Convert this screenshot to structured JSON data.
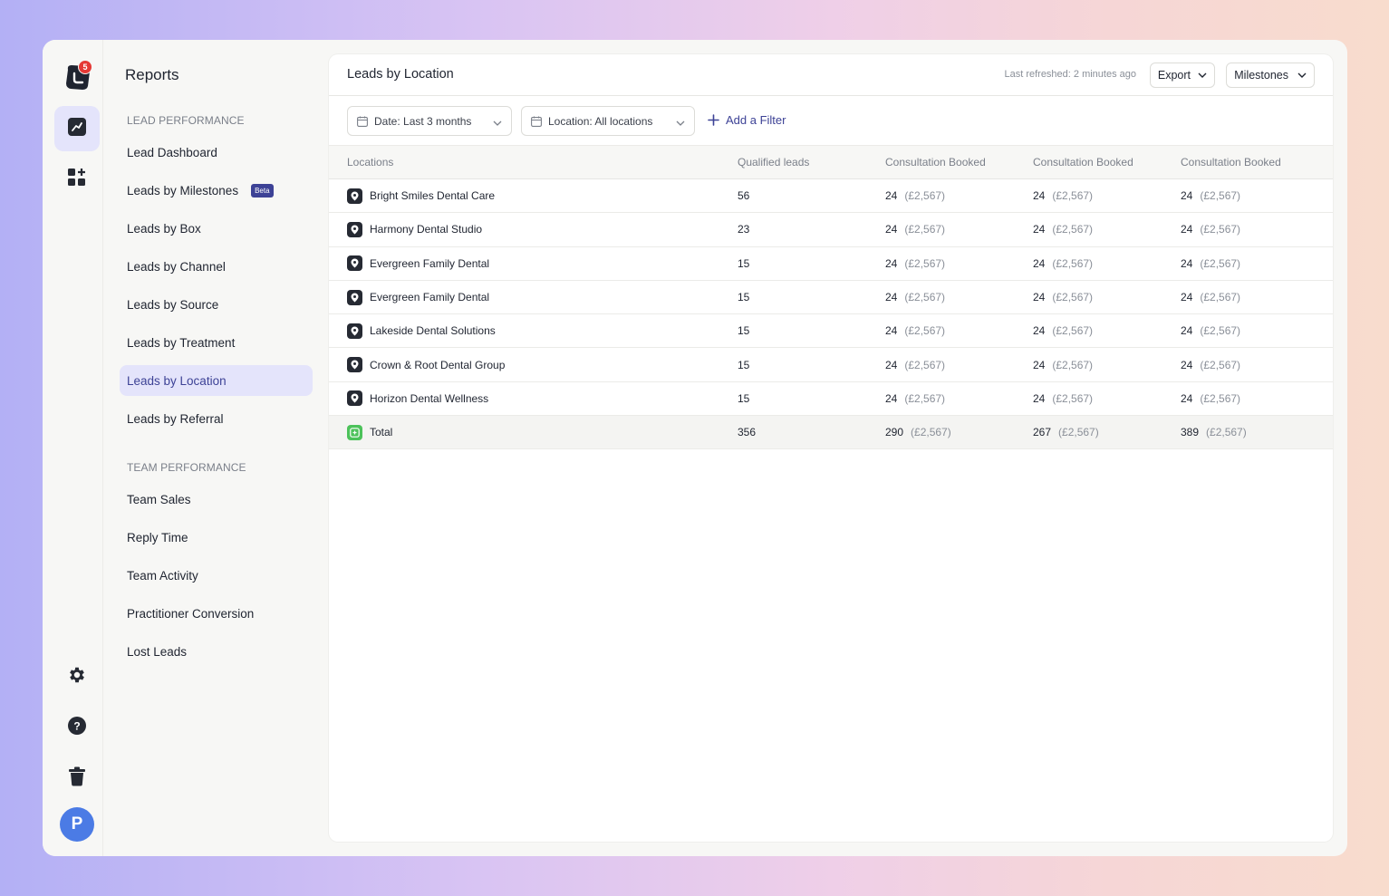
{
  "app": {
    "notification_count": "5",
    "user_initial": "P"
  },
  "nav": {
    "title": "Reports",
    "sections": [
      {
        "heading": "LEAD PERFORMANCE"
      },
      {
        "heading": "TEAM PERFORMANCE"
      }
    ],
    "items": [
      {
        "label": "Lead Dashboard"
      },
      {
        "label": "Leads by Milestones",
        "badge": "Beta"
      },
      {
        "label": "Leads by Box"
      },
      {
        "label": "Leads by Channel"
      },
      {
        "label": "Leads by Source"
      },
      {
        "label": "Leads by Treatment"
      },
      {
        "label": "Leads by Location",
        "active": true
      },
      {
        "label": "Leads by Referral"
      },
      {
        "label": "Team Sales"
      },
      {
        "label": "Reply Time"
      },
      {
        "label": "Team Activity"
      },
      {
        "label": "Practitioner Conversion"
      },
      {
        "label": "Lost Leads"
      }
    ]
  },
  "header": {
    "title": "Leads by Location",
    "last_refreshed": "Last refreshed: 2 minutes ago",
    "export_label": "Export",
    "milestones_label": "Milestones"
  },
  "filters": {
    "date": "Date: Last 3 months",
    "location": "Location: All locations",
    "add_filter": "Add a Filter"
  },
  "table": {
    "columns": [
      "Locations",
      "Qualified leads",
      "Consultation Booked",
      "Consultation Booked",
      "Consultation Booked"
    ],
    "rows": [
      {
        "name": "Bright Smiles Dental Care",
        "qualified": "56",
        "c1": "24",
        "a1": "(£2,567)",
        "c2": "24",
        "a2": "(£2,567)",
        "c3": "24",
        "a3": "(£2,567)"
      },
      {
        "name": "Harmony Dental Studio",
        "qualified": "23",
        "c1": "24",
        "a1": "(£2,567)",
        "c2": "24",
        "a2": "(£2,567)",
        "c3": "24",
        "a3": "(£2,567)"
      },
      {
        "name": "Evergreen Family Dental",
        "qualified": "15",
        "c1": "24",
        "a1": "(£2,567)",
        "c2": "24",
        "a2": "(£2,567)",
        "c3": "24",
        "a3": "(£2,567)"
      },
      {
        "name": "Evergreen Family Dental",
        "qualified": "15",
        "c1": "24",
        "a1": "(£2,567)",
        "c2": "24",
        "a2": "(£2,567)",
        "c3": "24",
        "a3": "(£2,567)"
      },
      {
        "name": "Lakeside Dental Solutions",
        "qualified": "15",
        "c1": "24",
        "a1": "(£2,567)",
        "c2": "24",
        "a2": "(£2,567)",
        "c3": "24",
        "a3": "(£2,567)"
      },
      {
        "name": "Crown & Root Dental Group",
        "qualified": "15",
        "c1": "24",
        "a1": "(£2,567)",
        "c2": "24",
        "a2": "(£2,567)",
        "c3": "24",
        "a3": "(£2,567)"
      },
      {
        "name": "Horizon Dental Wellness",
        "qualified": "15",
        "c1": "24",
        "a1": "(£2,567)",
        "c2": "24",
        "a2": "(£2,567)",
        "c3": "24",
        "a3": "(£2,567)"
      }
    ],
    "total": {
      "name": "Total",
      "qualified": "356",
      "c1": "290",
      "a1": "(£2,567)",
      "c2": "267",
      "a2": "(£2,567)",
      "c3": "389",
      "a3": "(£2,567)"
    }
  },
  "colors": {
    "accent": "#3d4296",
    "active_bg": "#e4e4fb",
    "badge_red": "#e53935",
    "avatar_blue": "#4b7be5",
    "total_green": "#4cc25a"
  }
}
